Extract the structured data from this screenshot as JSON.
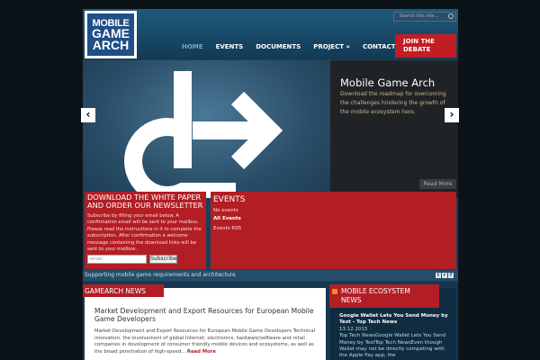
{
  "header": {
    "logo_lines": [
      "MOBILE",
      "GAME",
      "ARCH"
    ],
    "search_placeholder": "Search this site...",
    "nav": [
      "HOME",
      "EVENTS",
      "DOCUMENTS",
      "PROJECT »",
      "CONTACT"
    ],
    "active_nav": "HOME",
    "join_label_line1": "JOIN THE",
    "join_label_line2": "DEBATE"
  },
  "slider": {
    "title": "Mobile Game Arch",
    "text": "Download the roadmap for overcoming the challenges hindering the growth of the mobile ecosystem here.",
    "read_more": "Read More",
    "prev": "‹",
    "next": "›"
  },
  "newsletter": {
    "title": "DOWNLOAD THE WHITE PAPER AND ORDER OUR NEWSLETTER",
    "text": "Subscribe by filling your email below. A confirmation email will be sent to your mailbox. Please read the instructions in it to complete the subscription. After confirmation a welcome message containing the download links will be sent to your mailbox.",
    "email_placeholder": "email",
    "subscribe": "Subscribe"
  },
  "events": {
    "title": "EVENTS",
    "no_events": "No events",
    "all_events": "All Events",
    "rss": "Events RSS"
  },
  "tagline": "Supporting mobile game requirements and architecture",
  "gamearch_news": {
    "heading": "GAMEARCH NEWS",
    "article_title": "Market Development and Export Resources for European Mobile Game Developers",
    "article_text": "Market Development and Export Resources for European Mobile Game Developers Technical innovation, the involvement of global Internet, electronics, hardware/software and retail companies in development of consumer friendly mobile devices and ecosystems, as well as the broad penetration of high-speed...",
    "read_more": "Read More"
  },
  "mobile_ecosystem": {
    "heading_line1": "MOBILE ECOSYSTEM",
    "heading_line2": "NEWS",
    "item_title": "Google Wallet Lets You Send Money by Text - Top Tech News",
    "item_date": "13.12.2015",
    "item_text": "Top Tech NewsGoogle Wallet Lets You Send Money by TextTop Tech NewsEven though Wallet may not be directly competing with the Apple Pay app, the"
  },
  "colors": {
    "brand_red": "#b21e24",
    "header_blue": "#1e5a7d",
    "active_nav": "#79a6c2"
  }
}
